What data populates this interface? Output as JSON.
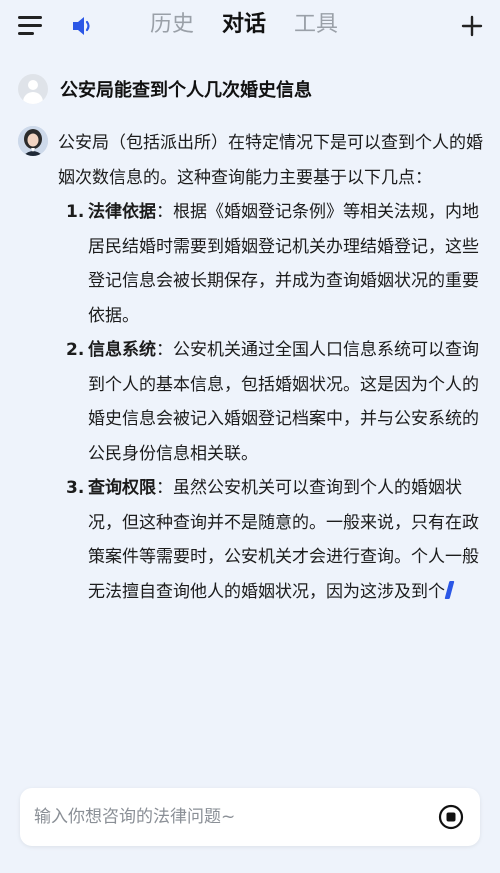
{
  "header": {
    "tabs": [
      {
        "label": "历史",
        "active": false
      },
      {
        "label": "对话",
        "active": true
      },
      {
        "label": "工具",
        "active": false
      }
    ]
  },
  "question": {
    "text": "公安局能查到个人几次婚史信息"
  },
  "answer": {
    "intro": "公安局（包括派出所）在特定情况下是可以查到个人的婚姻次数信息的。这种查询能力主要基于以下几点：",
    "points": [
      {
        "num": "1.",
        "term": "法律依据",
        "text": "：根据《婚姻登记条例》等相关法规，内地居民结婚时需要到婚姻登记机关办理结婚登记，这些登记信息会被长期保存，并成为查询婚姻状况的重要依据。"
      },
      {
        "num": "2.",
        "term": "信息系统",
        "text": "：公安机关通过全国人口信息系统可以查询到个人的基本信息，包括婚姻状况。这是因为个人的婚史信息会被记入婚姻登记档案中，并与公安系统的公民身份信息相关联。"
      },
      {
        "num": "3.",
        "term": "查询权限",
        "text": "：虽然公安机关可以查询到个人的婚姻状况，但这种查询并不是随意的。一般来说，只有在政策案件等需要时，公安机关才会进行查询。个人一般无法擅自查询他人的婚姻状况，因为这涉及到个"
      }
    ]
  },
  "input": {
    "placeholder": "输入你想咨询的法律问题~",
    "value": ""
  },
  "icons": {
    "menu": "menu-icon",
    "speaker": "speaker-icon",
    "plus": "plus-icon",
    "user_avatar": "user-avatar-icon",
    "assistant_avatar": "assistant-avatar",
    "stop": "stop-icon"
  },
  "colors": {
    "accent": "#2b57e6",
    "background": "#eef3fb"
  }
}
